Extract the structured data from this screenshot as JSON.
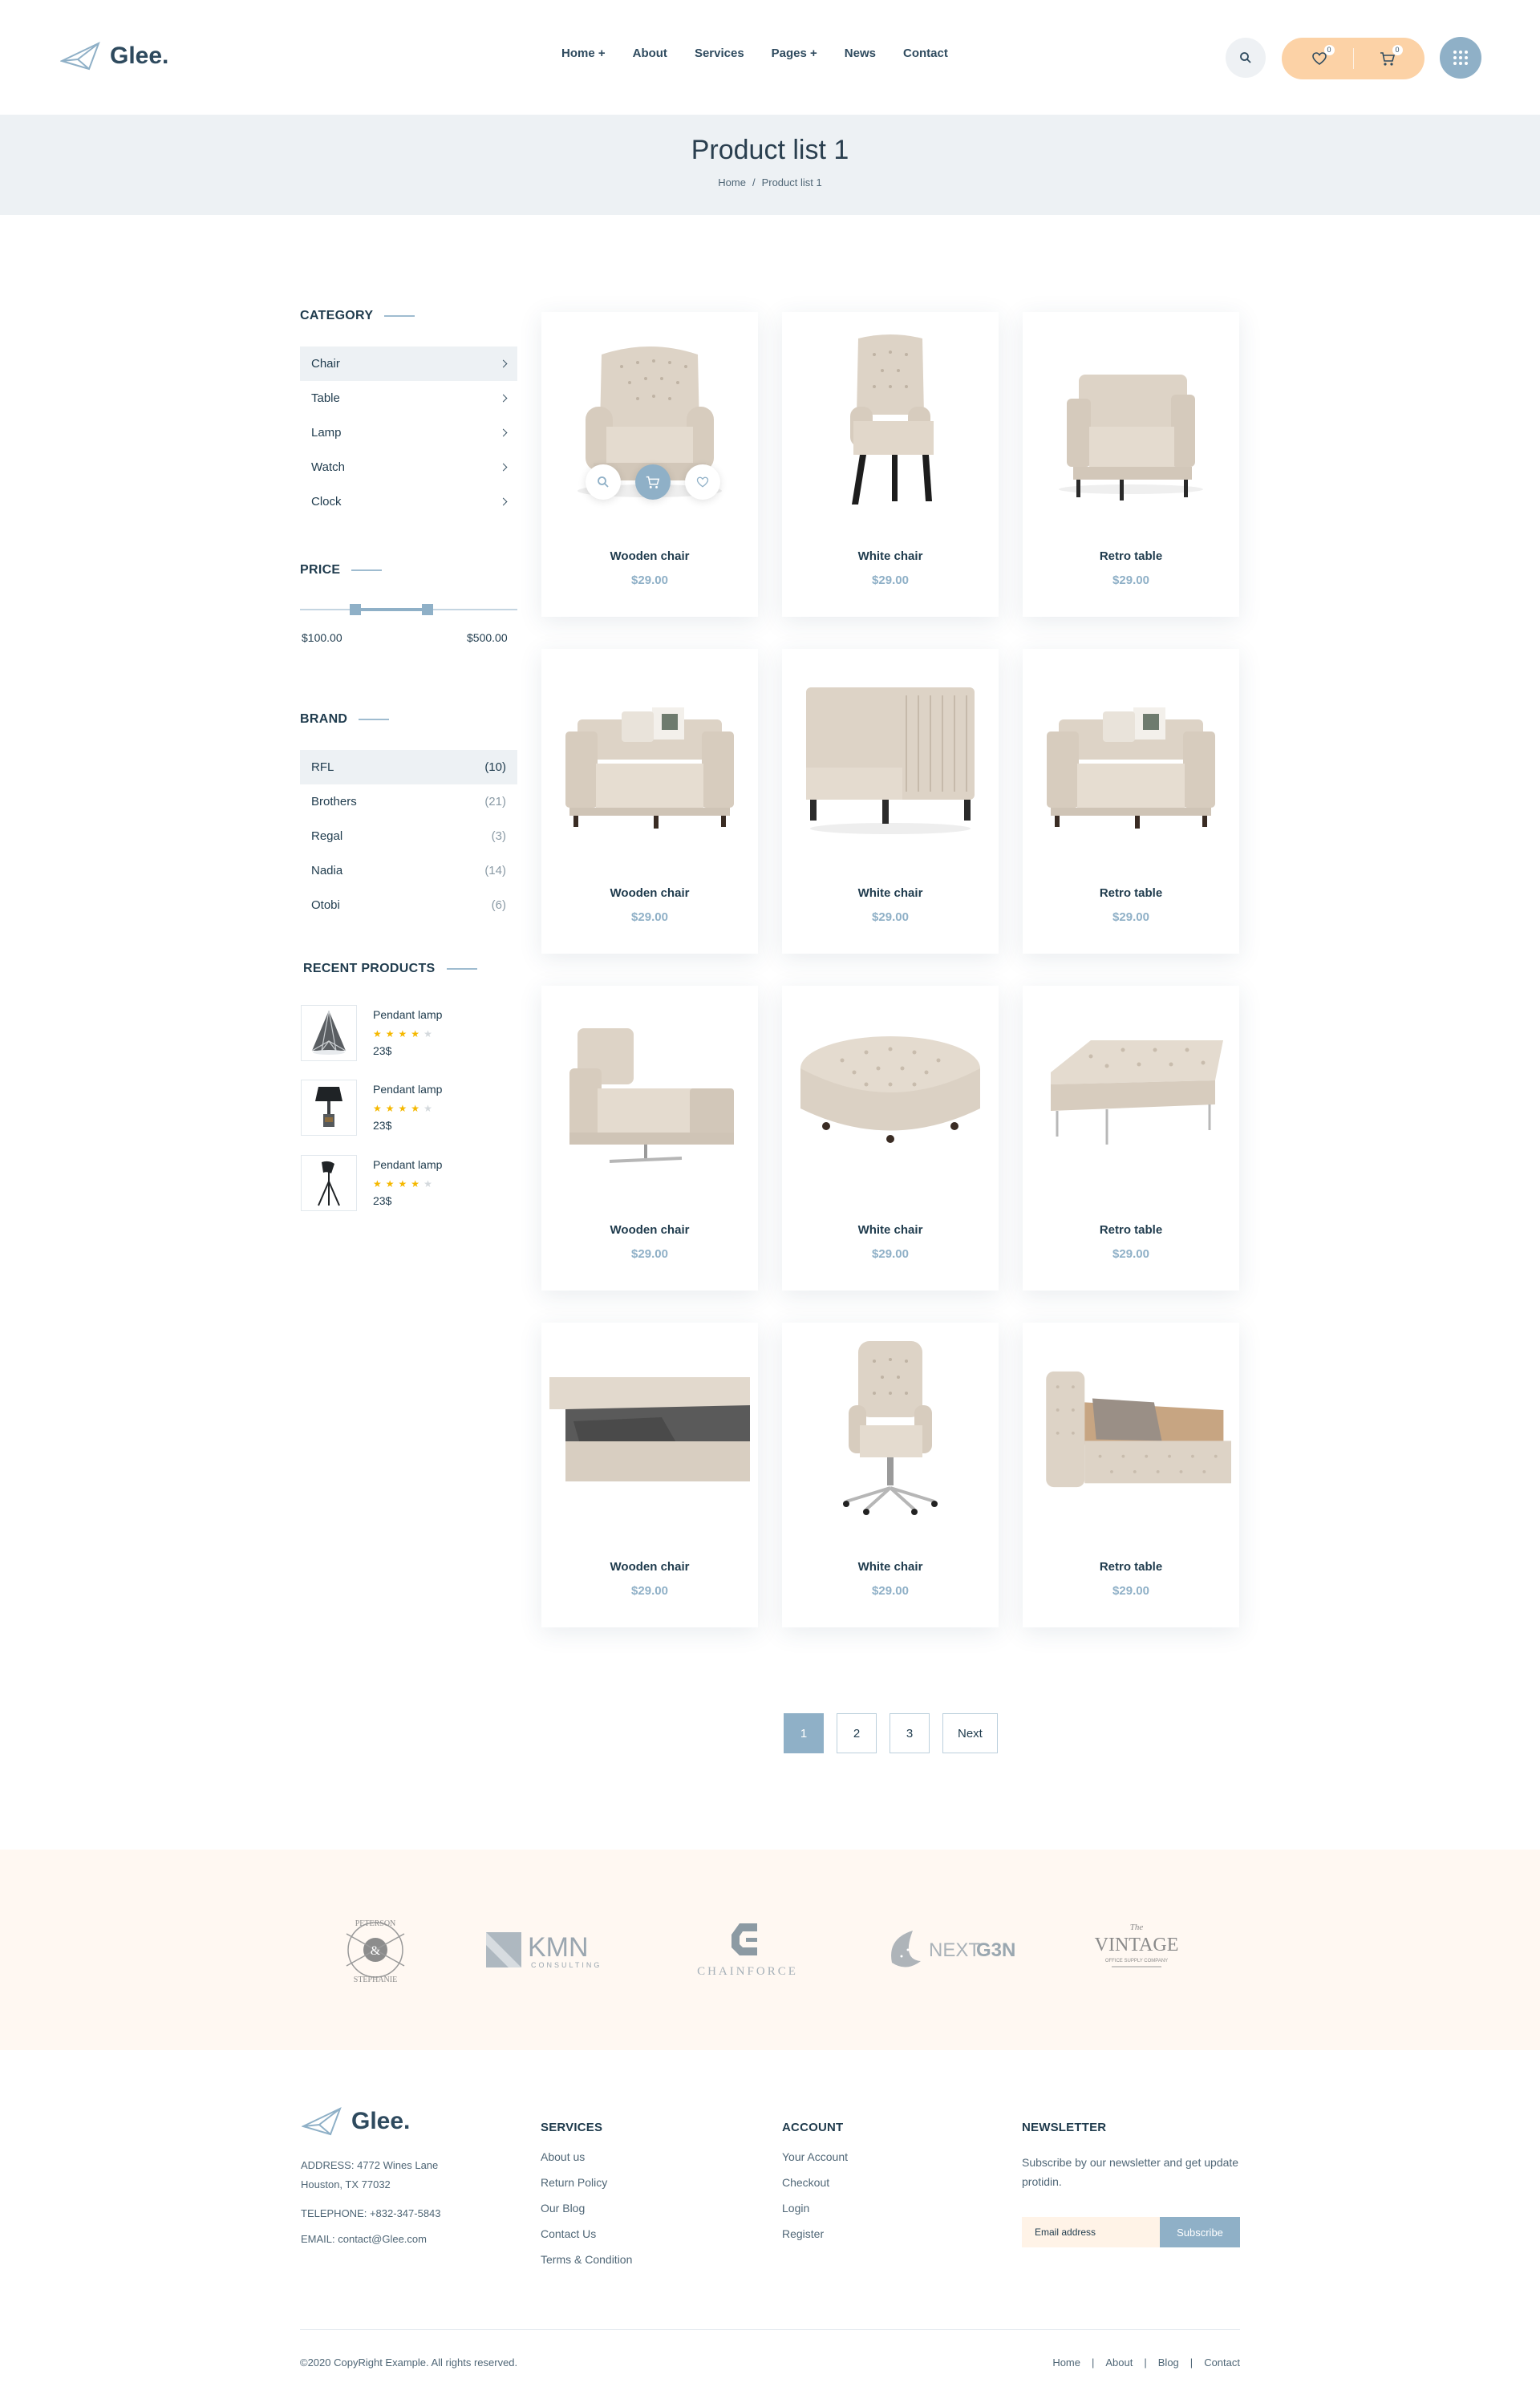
{
  "brand": {
    "name": "Glee."
  },
  "nav": [
    "Home +",
    "About",
    "Services",
    "Pages +",
    "News",
    "Contact"
  ],
  "header": {
    "wishlist_count": "0",
    "cart_count": "0"
  },
  "page": {
    "title": "Product list 1",
    "breadcrumb": [
      "Home",
      "Product list 1"
    ]
  },
  "sidebar": {
    "category_title": "CATEGORY",
    "categories": [
      "Chair",
      "Table",
      "Lamp",
      "Watch",
      "Clock"
    ],
    "price_title": "PRICE",
    "price_min": "$100.00",
    "price_max": "$500.00",
    "brand_title": "BRAND",
    "brands": [
      {
        "name": "RFL",
        "count": "(10)"
      },
      {
        "name": "Brothers",
        "count": "(21)"
      },
      {
        "name": "Regal",
        "count": "(3)"
      },
      {
        "name": "Nadia",
        "count": "(14)"
      },
      {
        "name": "Otobi",
        "count": "(6)"
      }
    ],
    "recent_title": "RECENT PRODUCTS",
    "recent": [
      {
        "name": "Pendant lamp",
        "price": "23$",
        "rating": 4
      },
      {
        "name": "Pendant lamp",
        "price": "23$",
        "rating": 4
      },
      {
        "name": "Pendant lamp",
        "price": "23$",
        "rating": 4
      }
    ]
  },
  "products": [
    {
      "name": "Wooden chair",
      "price": "$29.00"
    },
    {
      "name": "White chair",
      "price": "$29.00"
    },
    {
      "name": "Retro table",
      "price": "$29.00"
    },
    {
      "name": "Wooden chair",
      "price": "$29.00"
    },
    {
      "name": "White chair",
      "price": "$29.00"
    },
    {
      "name": "Retro table",
      "price": "$29.00"
    },
    {
      "name": "Wooden chair",
      "price": "$29.00"
    },
    {
      "name": "White chair",
      "price": "$29.00"
    },
    {
      "name": "Retro table",
      "price": "$29.00"
    },
    {
      "name": "Wooden chair",
      "price": "$29.00"
    },
    {
      "name": "White chair",
      "price": "$29.00"
    },
    {
      "name": "Retro table",
      "price": "$29.00"
    }
  ],
  "pagination": {
    "pages": [
      "1",
      "2",
      "3"
    ],
    "next": "Next",
    "active": "1"
  },
  "partners": {
    "peterson": {
      "top": "PETERSON",
      "bottom": "STEPHANIE",
      "mid": "&"
    },
    "kmn": {
      "main": "KMN",
      "sub": "CONSULTING"
    },
    "chainforce": {
      "main": "CHAINFORCE"
    },
    "nextgen": {
      "a": "NEXT",
      "b": "G3N"
    },
    "vintage": {
      "small": "The",
      "main": "VINTAGE",
      "sub": "OFFICE SUPPLY COMPANY"
    }
  },
  "footer": {
    "address_lines": [
      "ADDRESS: 4772 Wines Lane",
      "Houston, TX 77032"
    ],
    "telephone": "TELEPHONE: +832-347-5843",
    "email": "EMAIL: contact@Glee.com",
    "services_title": "SERVICES",
    "services": [
      "About us",
      "Return Policy",
      "Our Blog",
      "Contact Us",
      "Terms & Condition"
    ],
    "account_title": "ACCOUNT",
    "account": [
      "Your Account",
      "Checkout",
      "Login",
      "Register"
    ],
    "newsletter_title": "NEWSLETTER",
    "newsletter_text": "Subscribe by our newsletter and get update protidin.",
    "email_placeholder": "Email address",
    "subscribe": "Subscribe",
    "copyright": "©2020 CopyRight Example. All rights reserved.",
    "bottom_links": [
      "Home",
      "About",
      "Blog",
      "Contact"
    ]
  },
  "colors": {
    "accent": "#8fb0c7",
    "peach": "#fcd2a6",
    "band": "#edf1f4",
    "cream": "#fff8f2",
    "star": "#f5b800"
  }
}
